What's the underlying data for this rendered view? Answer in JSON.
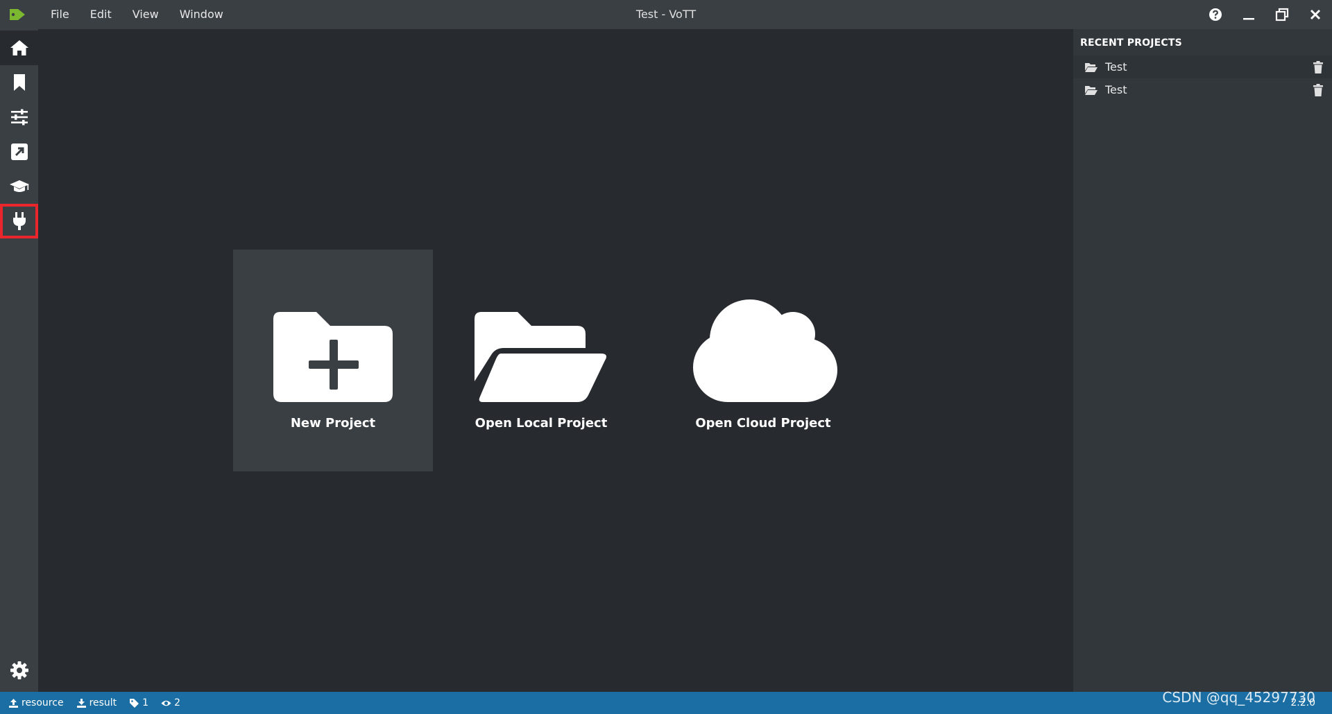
{
  "window": {
    "title": "Test - VoTT",
    "menu": [
      "File",
      "Edit",
      "View",
      "Window"
    ]
  },
  "sidebar": {
    "items": [
      {
        "icon": "home-icon",
        "active": true
      },
      {
        "icon": "bookmark-icon"
      },
      {
        "icon": "sliders-icon"
      },
      {
        "icon": "export-icon"
      },
      {
        "icon": "graduation-cap-icon"
      },
      {
        "icon": "plug-icon",
        "highlighted": true
      }
    ],
    "bottom_icon": "gear-icon"
  },
  "main": {
    "cards": [
      {
        "label": "New Project",
        "icon": "folder-plus-icon",
        "selected": true
      },
      {
        "label": "Open Local Project",
        "icon": "folder-open-icon"
      },
      {
        "label": "Open Cloud Project",
        "icon": "cloud-icon"
      }
    ]
  },
  "recent": {
    "title": "RECENT PROJECTS",
    "projects": [
      {
        "name": "Test"
      },
      {
        "name": "Test"
      }
    ]
  },
  "statusbar": {
    "source": "resource",
    "target": "result",
    "tags": "1",
    "visited": "2",
    "version": "2.2.0"
  },
  "watermark": "CSDN @qq_45297730",
  "colors": {
    "titlebar": "#3a3f44",
    "background": "#272b30",
    "statusbar": "#1b6ea3",
    "highlight": "#e8262b",
    "logo": "#7cb82f"
  }
}
